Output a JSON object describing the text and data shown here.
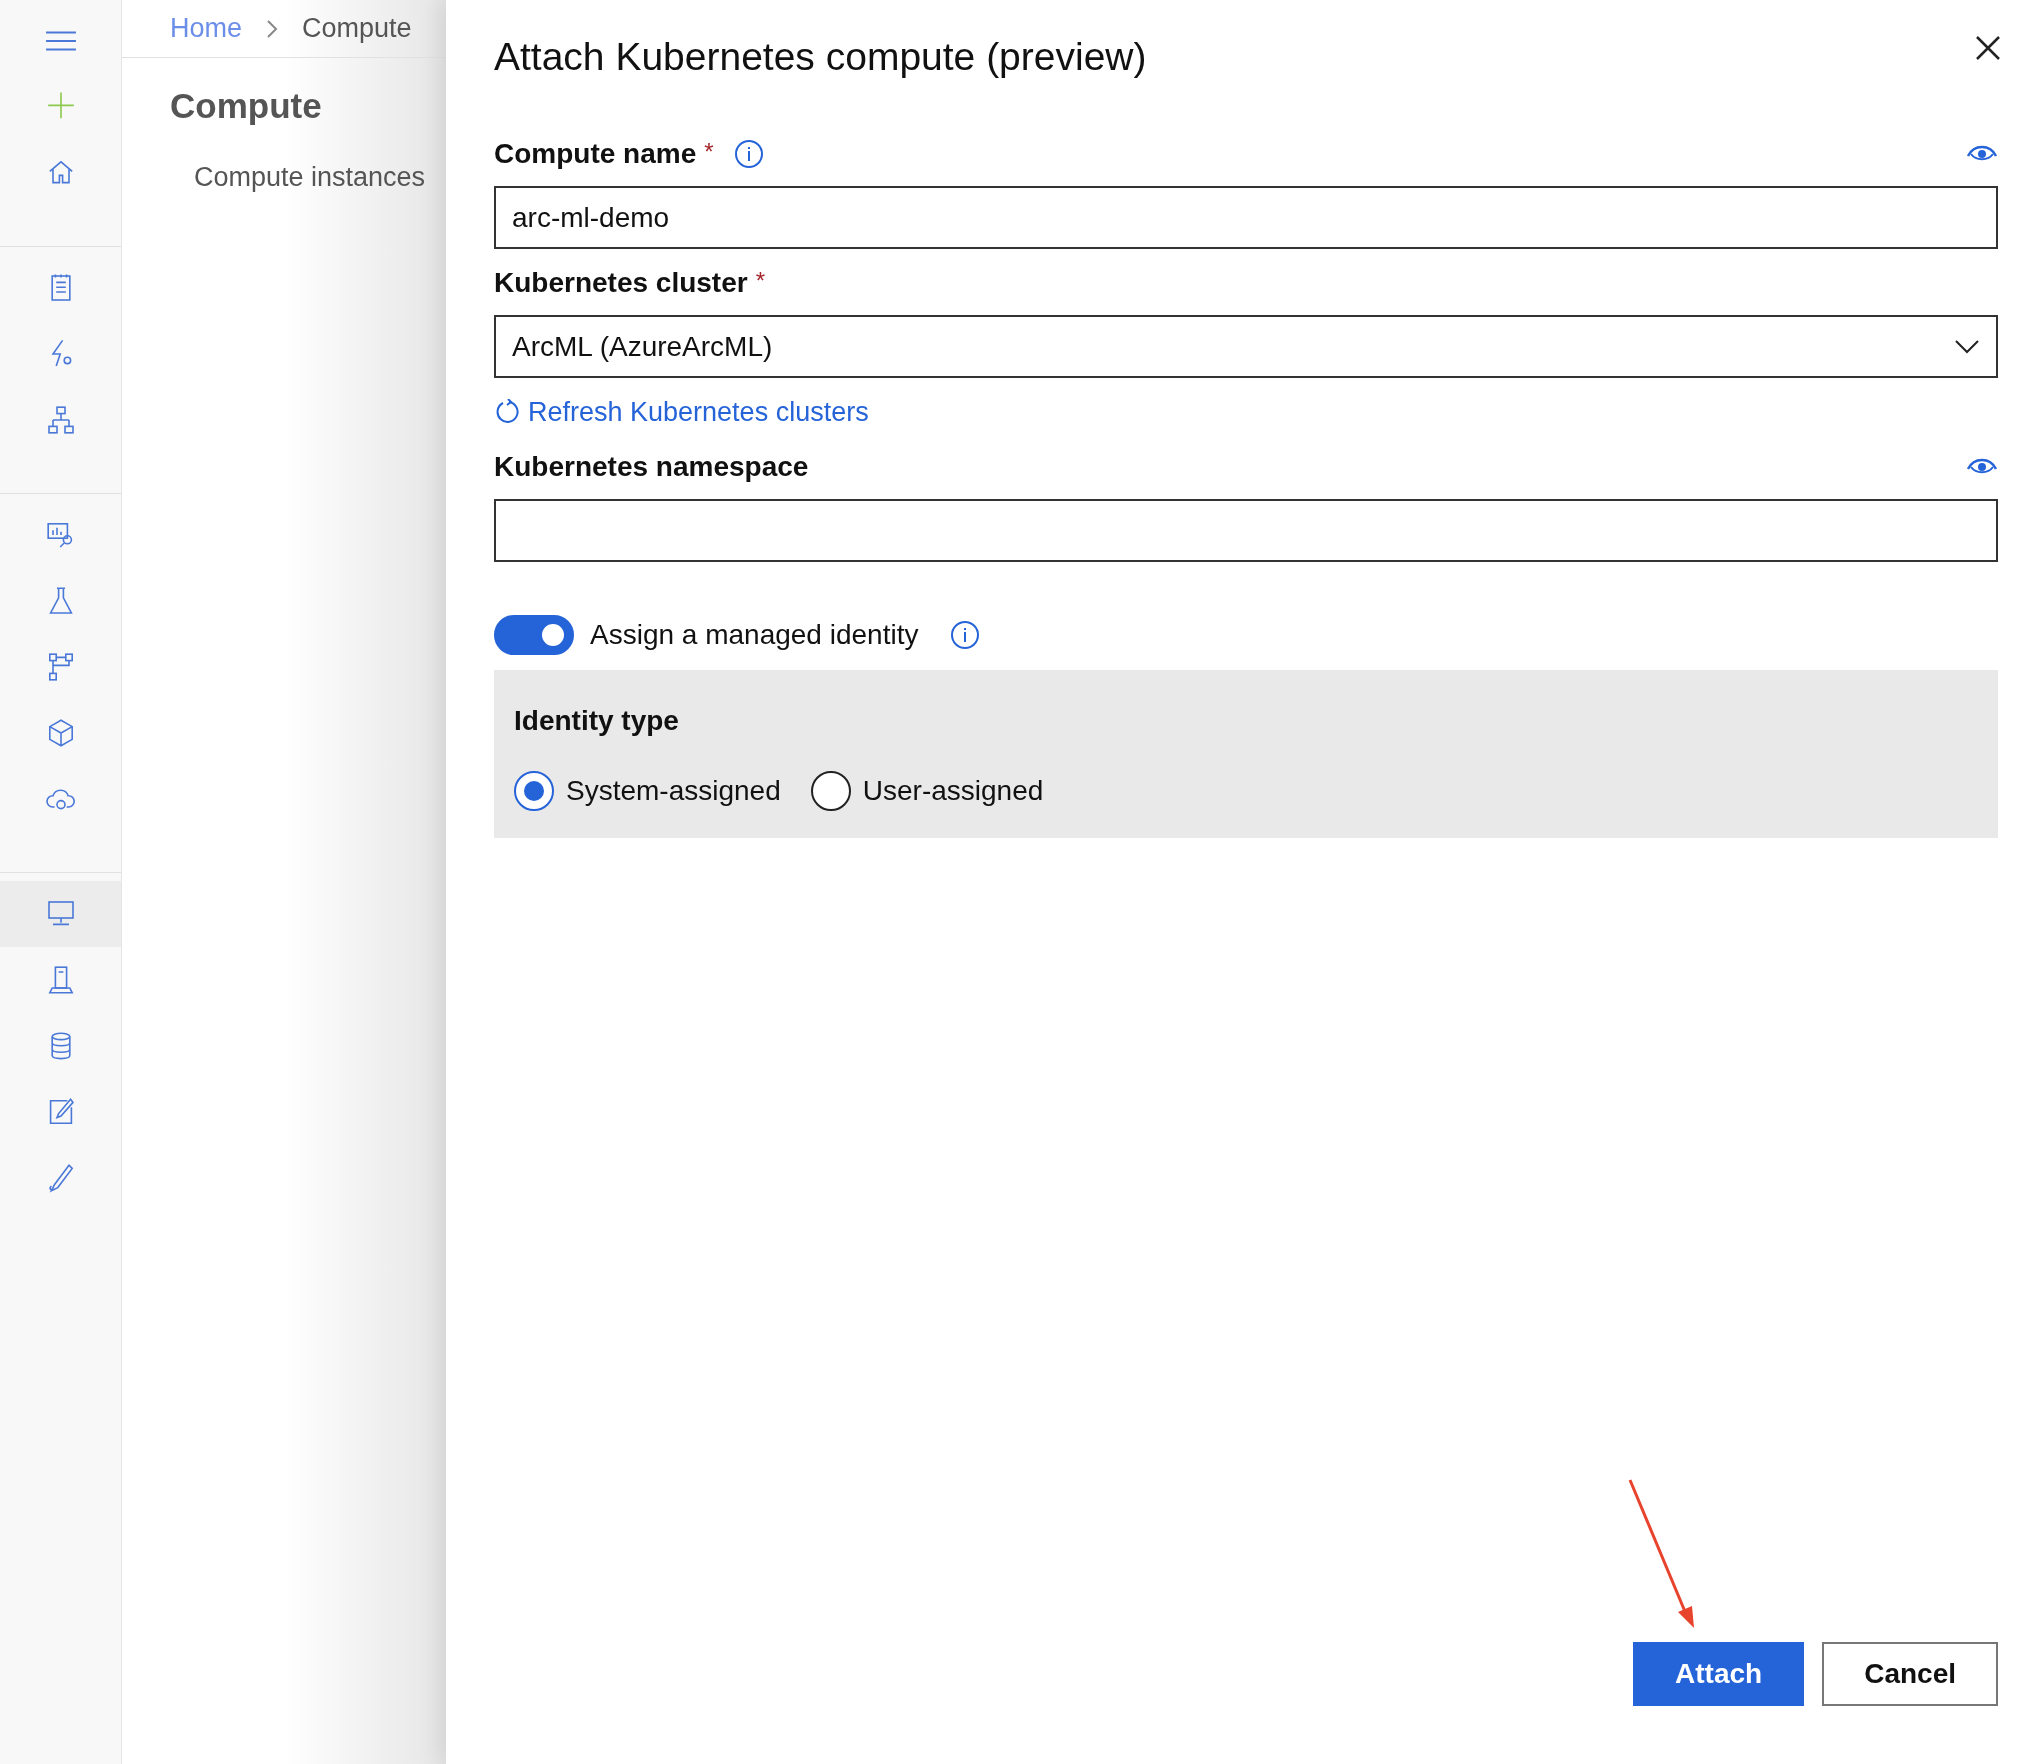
{
  "sidebar": {
    "groups": [
      {
        "items": [
          {
            "selected": false
          },
          {
            "selected": false
          },
          {
            "selected": false
          }
        ]
      },
      {
        "items": [
          {
            "selected": false
          },
          {
            "selected": false
          },
          {
            "selected": false
          }
        ]
      },
      {
        "items": [
          {
            "selected": false
          },
          {
            "selected": false
          },
          {
            "selected": false
          },
          {
            "selected": false
          },
          {
            "selected": false
          }
        ]
      },
      {
        "items": [
          {
            "selected": true
          },
          {
            "selected": false
          },
          {
            "selected": false
          },
          {
            "selected": false
          },
          {
            "selected": false
          }
        ]
      }
    ]
  },
  "breadcrumb": [
    "Home",
    "Compute"
  ],
  "page": {
    "title": "Compute",
    "nav_items": [
      "Compute instances"
    ]
  },
  "panel": {
    "title": "Attach Kubernetes compute (preview)",
    "fields": [
      {
        "kind": "text",
        "label": "Compute name",
        "required_mark": "*",
        "info": true,
        "eye": true,
        "value": "arc-ml-demo"
      },
      {
        "kind": "select",
        "label": "Kubernetes cluster",
        "required_mark": "*",
        "info": false,
        "eye": false,
        "value": "ArcML (AzureArcML)",
        "link": "Refresh Kubernetes clusters"
      },
      {
        "kind": "text",
        "label": "Kubernetes namespace",
        "info": false,
        "eye": true
      }
    ],
    "toggle": {
      "label": "Assign a managed identity",
      "on": true
    },
    "identity": {
      "title": "Identity type",
      "options": [
        {
          "label": "System-assigned",
          "selected": true
        },
        {
          "label": "User-assigned",
          "selected": false
        }
      ]
    },
    "buttons": [
      {
        "kind": "primary",
        "label": "Attach"
      },
      {
        "kind": "secondary",
        "label": "Cancel"
      }
    ]
  }
}
